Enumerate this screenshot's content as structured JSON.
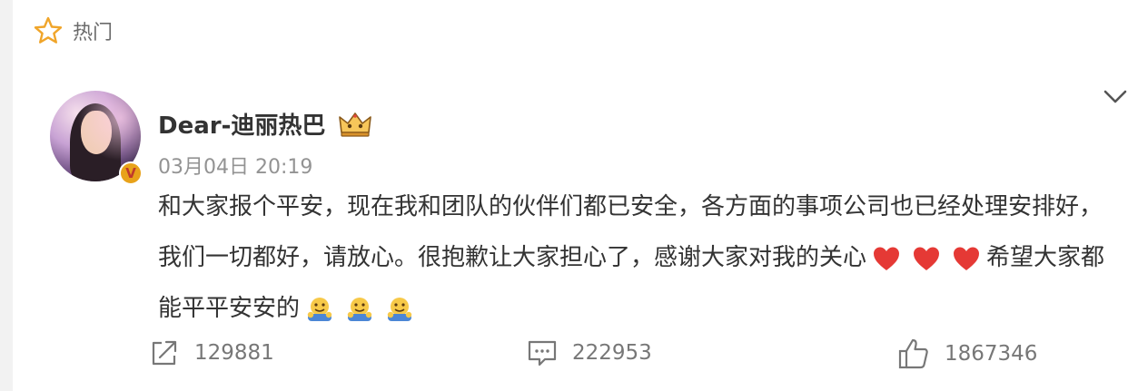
{
  "header": {
    "label": "热门",
    "icon": "star-icon"
  },
  "post": {
    "author": {
      "name": "Dear-迪丽热巴",
      "badge": "V",
      "crown_icon": "crown-icon"
    },
    "time": "03月04日 20:19",
    "text": {
      "part1": "和大家报个平安，现在我和团队的伙伴们都已安全，各方面的事项公司也已经处理安排好，我们一切都好，请放心。很抱歉让大家担心了，感谢大家对我的关心",
      "part2": "希望大家都能平平安安的"
    }
  },
  "actions": {
    "repost": {
      "icon": "repost-icon",
      "count": "129881"
    },
    "comment": {
      "icon": "comment-icon",
      "count": "222953"
    },
    "like": {
      "icon": "thumbs-up-icon",
      "count": "1867346"
    }
  },
  "colors": {
    "heart": "#e53935",
    "star": "#f0a52a",
    "text": "#333333",
    "meta": "#939393"
  }
}
